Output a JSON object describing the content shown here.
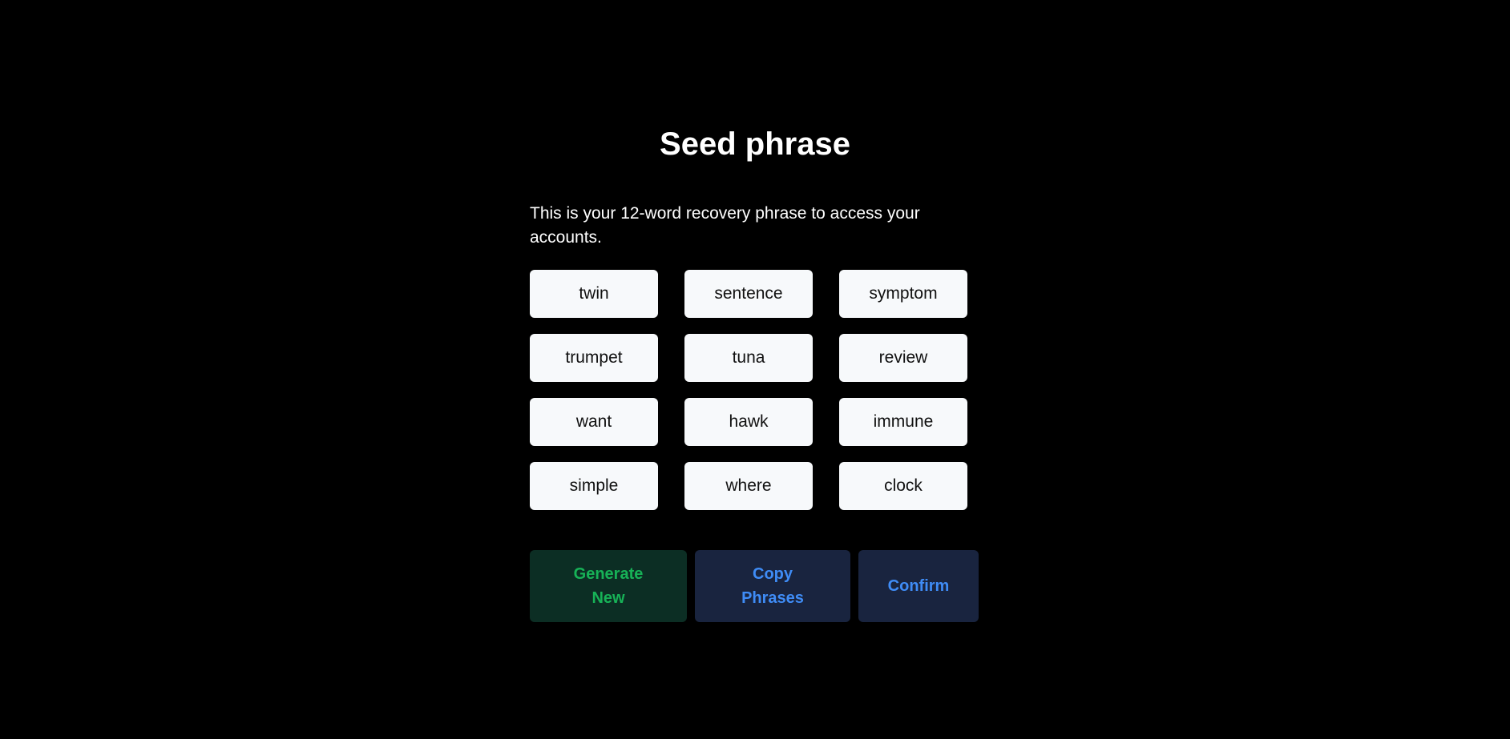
{
  "page": {
    "title": "Seed phrase",
    "description": "This is your 12-word recovery phrase to access your accounts."
  },
  "seed_words": [
    "twin",
    "sentence",
    "symptom",
    "trumpet",
    "tuna",
    "review",
    "want",
    "hawk",
    "immune",
    "simple",
    "where",
    "clock"
  ],
  "actions": {
    "generate_label": "Generate New",
    "copy_label": "Copy Phrases",
    "confirm_label": "Confirm"
  },
  "colors": {
    "background": "#000000",
    "card": "#f7f9fb",
    "generate_bg": "#0c2e24",
    "generate_text": "#17b257",
    "secondary_bg": "#19243f",
    "secondary_text": "#3f8cf6"
  }
}
